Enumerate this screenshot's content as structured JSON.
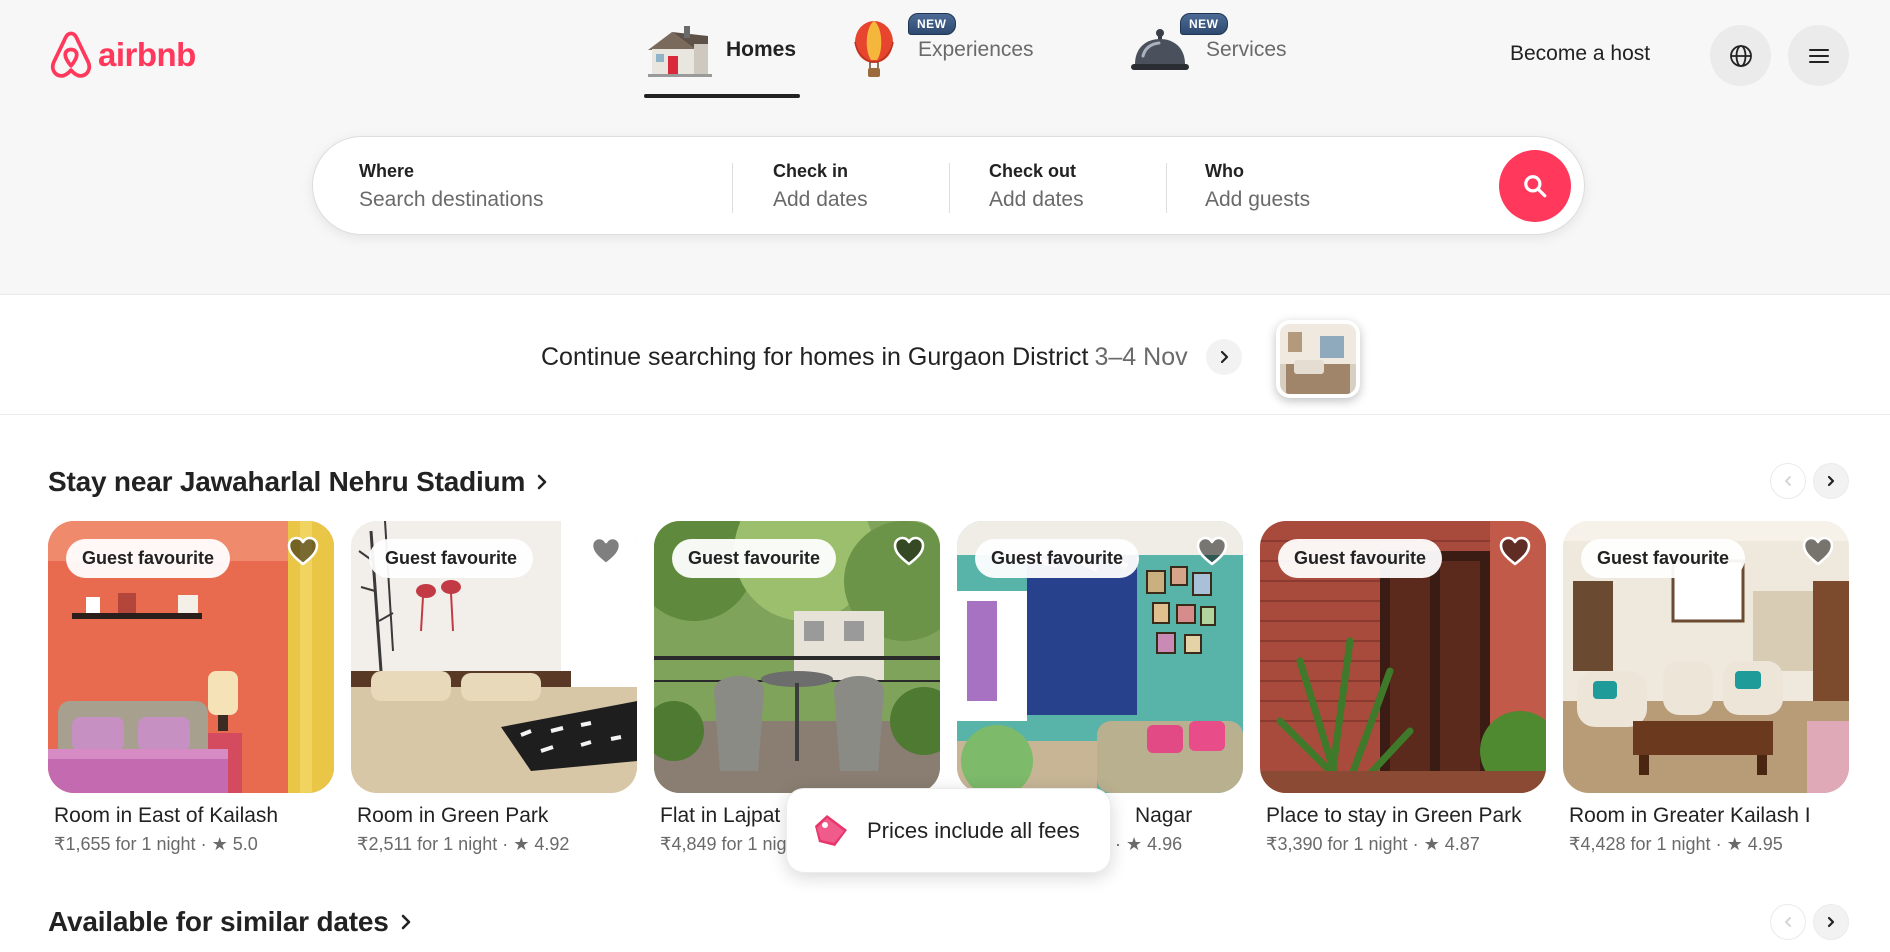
{
  "brand": {
    "name": "airbnb",
    "color": "#ff385c"
  },
  "nav": {
    "tabs": [
      {
        "label": "Homes",
        "icon": "house-icon",
        "active": true
      },
      {
        "label": "Experiences",
        "icon": "hot-air-balloon-icon",
        "badge": "NEW"
      },
      {
        "label": "Services",
        "icon": "service-bell-icon",
        "badge": "NEW"
      }
    ],
    "become_host": "Become a host"
  },
  "search": {
    "where": {
      "label": "Where",
      "placeholder": "Search destinations"
    },
    "check_in": {
      "label": "Check in",
      "value": "Add dates"
    },
    "check_out": {
      "label": "Check out",
      "value": "Add dates"
    },
    "who": {
      "label": "Who",
      "value": "Add guests"
    }
  },
  "continue": {
    "text": "Continue searching for homes in Gurgaon District",
    "dates": "3–4 Nov"
  },
  "sections": [
    {
      "title": "Stay near Jawaharlal Nehru Stadium"
    },
    {
      "title": "Available for similar dates"
    }
  ],
  "listings": [
    {
      "badge": "Guest favourite",
      "title": "Room in East of Kailash",
      "price": "₹1,655 for 1 night",
      "rating": "5.0"
    },
    {
      "badge": "Guest favourite",
      "title": "Room in Green Park",
      "price": "₹2,511 for 1 night",
      "rating": "4.92"
    },
    {
      "badge": "Guest favourite",
      "title": "Flat in Lajpat N",
      "price": "₹4,849 for 1 nig",
      "rating": ""
    },
    {
      "badge": "Guest favourite",
      "title": "Nagar",
      "price": "",
      "rating": "4.96"
    },
    {
      "badge": "Guest favourite",
      "title": "Place to stay in Green Park",
      "price": "₹3,390 for 1 night",
      "rating": "4.87"
    },
    {
      "badge": "Guest favourite",
      "title": "Room in Greater Kailash I",
      "price": "₹4,428 for 1 night",
      "rating": "4.95"
    }
  ],
  "toast": {
    "text": "Prices include all fees"
  }
}
